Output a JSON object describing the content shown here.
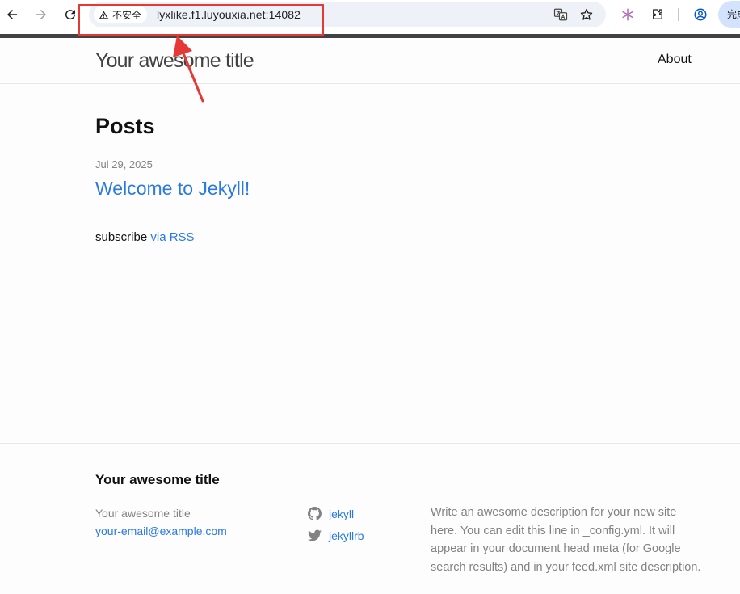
{
  "browser": {
    "security_label": "不安全",
    "url": "lyxlike.f1.luyouxia.net:14082",
    "profile_label": "完成"
  },
  "site": {
    "title": "Your awesome title",
    "nav": [
      {
        "label": "About"
      }
    ]
  },
  "main": {
    "heading": "Posts",
    "posts": [
      {
        "date": "Jul 29, 2025",
        "title": "Welcome to Jekyll!"
      }
    ],
    "subscribe_text": "subscribe",
    "rss_link": "via RSS"
  },
  "footer": {
    "heading": "Your awesome title",
    "name": "Your awesome title",
    "email": "your-email@example.com",
    "social": [
      {
        "icon": "github-icon",
        "label": "jekyll"
      },
      {
        "icon": "twitter-icon",
        "label": "jekyllrb"
      }
    ],
    "description": "Write an awesome description for your new site here. You can edit this line in _config.yml. It will appear in your document head meta (for Google search results) and in your feed.xml site description."
  },
  "colors": {
    "link": "#2a7ae2",
    "muted": "#828282",
    "annotation": "#e53935"
  }
}
